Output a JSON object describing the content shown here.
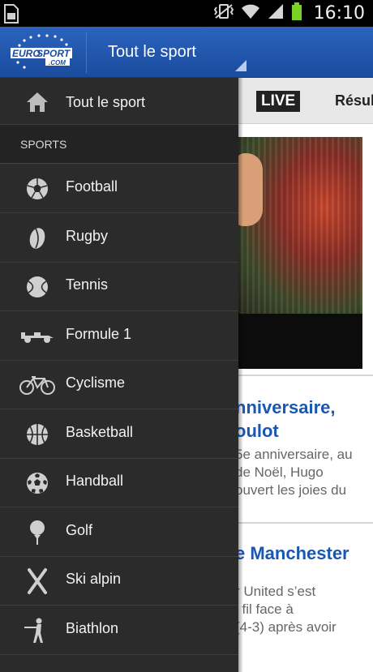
{
  "status_bar": {
    "time": "16:10",
    "icons": [
      "sim-card-icon",
      "vibrate-icon",
      "wifi-icon",
      "signal-icon",
      "battery-icon"
    ]
  },
  "app_bar": {
    "logo_line1": "EURO",
    "logo_line2": "SPORT",
    "logo_sub": ".COM",
    "title": "Tout le sport"
  },
  "tabs": {
    "live": "LIVE",
    "results": "Résul"
  },
  "articles": [
    {
      "title_line1": "nniversaire,",
      "title_line2": "oulot",
      "text_line1": "5e anniversaire, au",
      "text_line2": "de Noël, Hugo",
      "text_line3": "ouvert les joies du"
    },
    {
      "title_line1": "e Manchester",
      "text_line1": "r United s’est",
      "text_line2": "l fil face à",
      "text_line3": "(4-3) après avoir"
    }
  ],
  "drawer": {
    "home_label": "Tout le sport",
    "section_label": "SPORTS",
    "items": [
      {
        "label": "Football",
        "icon": "football-icon"
      },
      {
        "label": "Rugby",
        "icon": "rugby-ball-icon"
      },
      {
        "label": "Tennis",
        "icon": "tennis-ball-icon"
      },
      {
        "label": "Formule 1",
        "icon": "formula1-car-icon"
      },
      {
        "label": "Cyclisme",
        "icon": "bicycle-icon"
      },
      {
        "label": "Basketball",
        "icon": "basketball-icon"
      },
      {
        "label": "Handball",
        "icon": "handball-icon"
      },
      {
        "label": "Golf",
        "icon": "golf-ball-icon"
      },
      {
        "label": "Ski alpin",
        "icon": "ski-icon"
      },
      {
        "label": "Biathlon",
        "icon": "biathlon-icon"
      }
    ]
  },
  "colors": {
    "app_bar": "#2b63bd",
    "drawer_bg": "#2b2b2b",
    "article_title": "#1a57b1"
  }
}
